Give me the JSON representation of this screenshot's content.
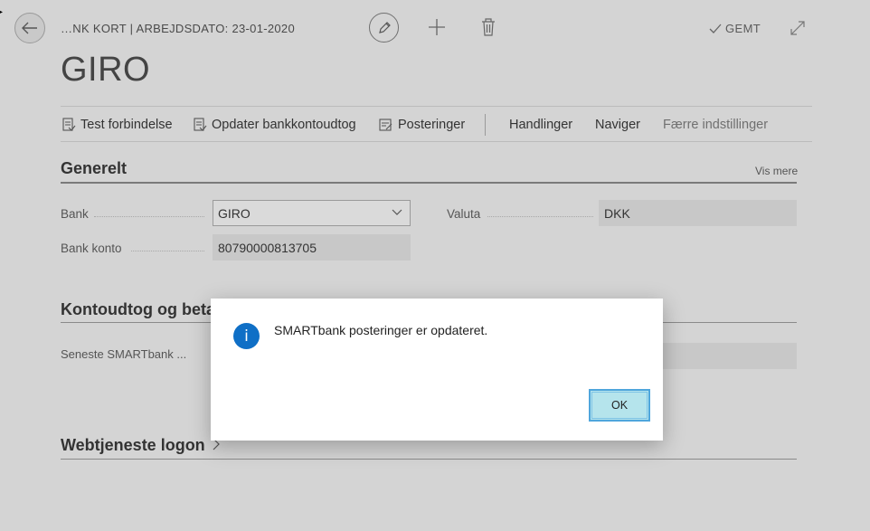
{
  "header": {
    "breadcrumb": "…NK KORT | ARBEJDSDATO: 23-01-2020",
    "saved_label": "GEMT",
    "title": "GIRO",
    "icons": [
      "back-arrow-icon",
      "pencil-icon",
      "plus-icon",
      "trash-icon",
      "checkmark-icon",
      "expand-icon"
    ]
  },
  "actions": {
    "test_connection": "Test forbindelse",
    "update_statement": "Opdater bankkontoudtog",
    "entries": "Posteringer",
    "actions_menu": "Handlinger",
    "navigate": "Naviger",
    "fewer_options": "Færre indstillinger"
  },
  "general": {
    "title": "Generelt",
    "show_more": "Vis mere",
    "bank_label": "Bank",
    "bank_value": "GIRO",
    "currency_label": "Valuta",
    "currency_value": "DKK",
    "account_label": "Bank konto",
    "account_value": "80790000813705"
  },
  "statement": {
    "title": "Kontoudtog og beta",
    "latest_label": "Seneste SMARTbank ..."
  },
  "webservice": {
    "title": "Webtjeneste logon"
  },
  "dialog": {
    "icon_letter": "i",
    "message": "SMARTbank posteringer er opdateret.",
    "ok_label": "OK"
  },
  "colors": {
    "overlay_bg": "#d4d4d4",
    "info_blue": "#0f6fc6",
    "ok_button": "#b5e4ec"
  }
}
